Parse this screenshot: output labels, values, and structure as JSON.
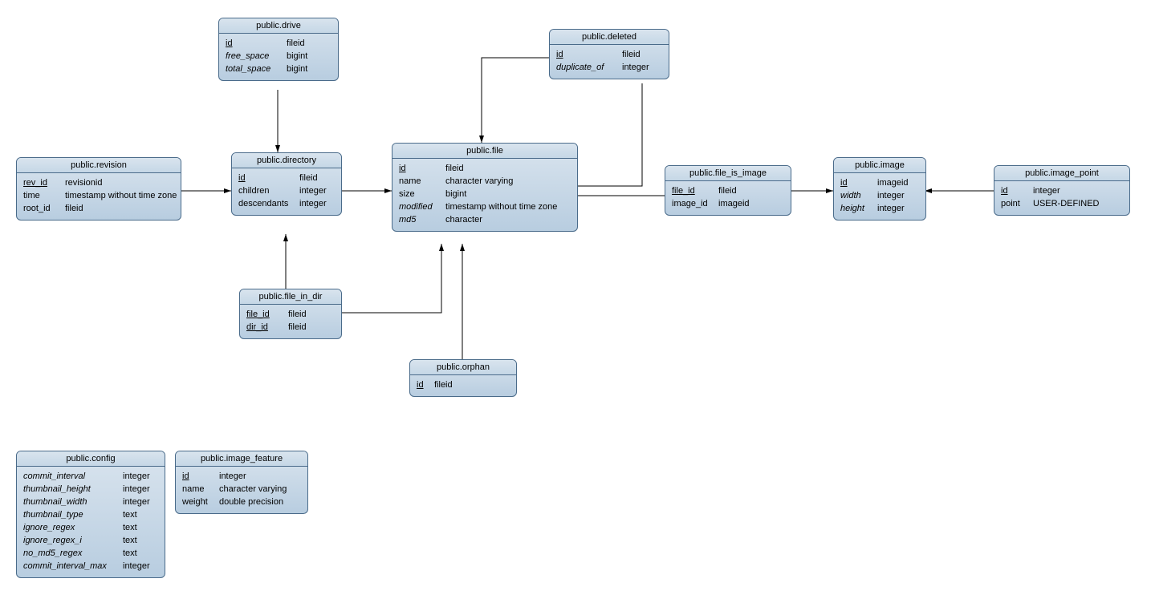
{
  "entities": {
    "drive": {
      "title": "public.drive",
      "columns": [
        {
          "name": "id",
          "type": "fileid",
          "pk": true
        },
        {
          "name": "free_space",
          "type": "bigint",
          "nullable": true
        },
        {
          "name": "total_space",
          "type": "bigint",
          "nullable": true
        }
      ]
    },
    "revision": {
      "title": "public.revision",
      "columns": [
        {
          "name": "rev_id",
          "type": "revisionid",
          "pk": true
        },
        {
          "name": "time",
          "type": "timestamp without time zone"
        },
        {
          "name": "root_id",
          "type": "fileid"
        }
      ]
    },
    "directory": {
      "title": "public.directory",
      "columns": [
        {
          "name": "id",
          "type": "fileid",
          "pk": true
        },
        {
          "name": "children",
          "type": "integer"
        },
        {
          "name": "descendants",
          "type": "integer"
        }
      ]
    },
    "file": {
      "title": "public.file",
      "columns": [
        {
          "name": "id",
          "type": "fileid",
          "pk": true
        },
        {
          "name": "name",
          "type": "character varying"
        },
        {
          "name": "size",
          "type": "bigint"
        },
        {
          "name": "modified",
          "type": "timestamp without time zone",
          "nullable": true
        },
        {
          "name": "md5",
          "type": "character",
          "nullable": true
        }
      ]
    },
    "deleted": {
      "title": "public.deleted",
      "columns": [
        {
          "name": "id",
          "type": "fileid",
          "pk": true
        },
        {
          "name": "duplicate_of",
          "type": "integer",
          "nullable": true
        }
      ]
    },
    "file_is_image": {
      "title": "public.file_is_image",
      "columns": [
        {
          "name": "file_id",
          "type": "fileid",
          "pk": true
        },
        {
          "name": "image_id",
          "type": "imageid"
        }
      ]
    },
    "image": {
      "title": "public.image",
      "columns": [
        {
          "name": "id",
          "type": "imageid",
          "pk": true
        },
        {
          "name": "width",
          "type": "integer",
          "nullable": true
        },
        {
          "name": "height",
          "type": "integer",
          "nullable": true
        }
      ]
    },
    "image_point": {
      "title": "public.image_point",
      "columns": [
        {
          "name": "id",
          "type": "integer",
          "pk": true
        },
        {
          "name": "point",
          "type": "USER-DEFINED"
        }
      ]
    },
    "file_in_dir": {
      "title": "public.file_in_dir",
      "columns": [
        {
          "name": "file_id",
          "type": "fileid",
          "pk": true
        },
        {
          "name": "dir_id",
          "type": "fileid",
          "pk": true
        }
      ]
    },
    "orphan": {
      "title": "public.orphan",
      "columns": [
        {
          "name": "id",
          "type": "fileid",
          "pk": true
        }
      ]
    },
    "config": {
      "title": "public.config",
      "columns": [
        {
          "name": "commit_interval",
          "type": "integer",
          "nullable": true
        },
        {
          "name": "thumbnail_height",
          "type": "integer",
          "nullable": true
        },
        {
          "name": "thumbnail_width",
          "type": "integer",
          "nullable": true
        },
        {
          "name": "thumbnail_type",
          "type": "text",
          "nullable": true
        },
        {
          "name": "ignore_regex",
          "type": "text",
          "nullable": true
        },
        {
          "name": "ignore_regex_i",
          "type": "text",
          "nullable": true
        },
        {
          "name": "no_md5_regex",
          "type": "text",
          "nullable": true
        },
        {
          "name": "commit_interval_max",
          "type": "integer",
          "nullable": true
        }
      ]
    },
    "image_feature": {
      "title": "public.image_feature",
      "columns": [
        {
          "name": "id",
          "type": "integer",
          "pk": true
        },
        {
          "name": "name",
          "type": "character varying"
        },
        {
          "name": "weight",
          "type": "double precision"
        }
      ]
    }
  }
}
